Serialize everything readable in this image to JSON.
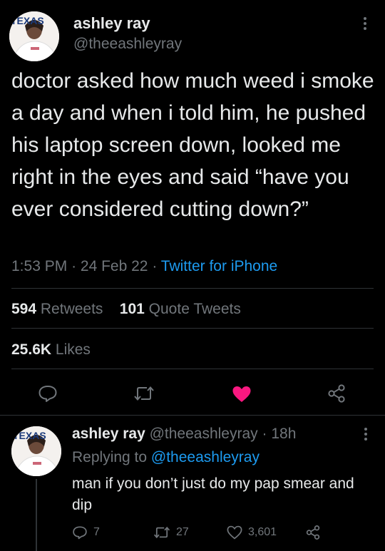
{
  "main_tweet": {
    "avatar_logo": "TEXAS",
    "author_name": "ashley ray",
    "author_handle": "@theeashleyray",
    "text": "doctor asked how much weed i smoke a day and when i told him, he pushed his laptop screen down, looked me right in the eyes and said “have you ever considered cutting down?”",
    "time": "1:53 PM",
    "separator": "·",
    "date": "24 Feb 22",
    "source": "Twitter for iPhone",
    "retweets_count": "594",
    "retweets_label": "Retweets",
    "quotes_count": "101",
    "quotes_label": "Quote Tweets",
    "likes_count": "25.6K",
    "likes_label": "Likes",
    "actions": [
      "reply-icon",
      "retweet-icon",
      "like-icon",
      "share-icon"
    ],
    "liked_color": "#f91880"
  },
  "reply": {
    "avatar_logo": "TEXAS",
    "author_name": "ashley ray",
    "author_handle": "@theeashleyray",
    "separator": "·",
    "age": "18h",
    "replying_label": "Replying to",
    "replying_handle": "@theeashleyray",
    "text": "man if you don’t just do my pap smear and dip",
    "reply_count": "7",
    "retweet_count": "27",
    "like_count": "3,601"
  },
  "colors": {
    "background": "#000000",
    "text": "#e7e9ea",
    "muted": "#71767b",
    "link": "#1d9bf0",
    "divider": "#2f3336"
  }
}
